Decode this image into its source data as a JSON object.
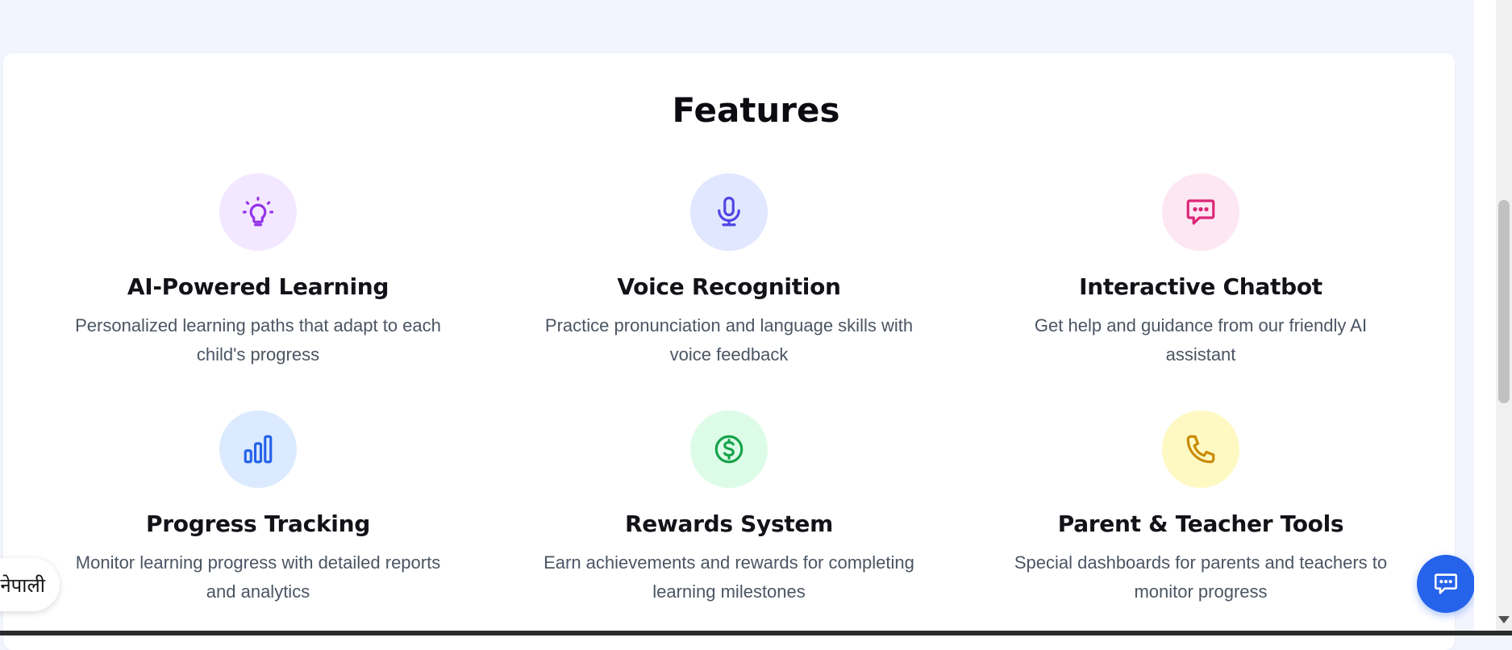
{
  "section": {
    "title": "Features"
  },
  "features": [
    {
      "title": "AI-Powered Learning",
      "desc_line1": "Personalized learning paths that adapt to each",
      "desc_line2": "child's progress",
      "icon": "lightbulb-icon",
      "bg": "#f3e8ff",
      "color": "#9333ea"
    },
    {
      "title": "Voice Recognition",
      "desc_line1": "Practice pronunciation and language skills with",
      "desc_line2": "voice feedback",
      "icon": "microphone-icon",
      "bg": "#e0e7ff",
      "color": "#4f46e5"
    },
    {
      "title": "Interactive Chatbot",
      "desc_line1": "Get help and guidance from our friendly AI",
      "desc_line2": "assistant",
      "icon": "chat-bubble-icon",
      "bg": "#fce7f3",
      "color": "#db2777"
    },
    {
      "title": "Progress Tracking",
      "desc_line1": "Monitor learning progress with detailed reports",
      "desc_line2": "and analytics",
      "icon": "bar-chart-icon",
      "bg": "#dbeafe",
      "color": "#2563eb"
    },
    {
      "title": "Rewards System",
      "desc_line1": "Earn achievements and rewards for completing",
      "desc_line2": "learning milestones",
      "icon": "dollar-coin-icon",
      "bg": "#dcfce7",
      "color": "#16a34a"
    },
    {
      "title": "Parent & Teacher Tools",
      "desc_line1": "Special dashboards for parents and teachers to",
      "desc_line2": "monitor progress",
      "icon": "phone-icon",
      "bg": "#fef9c3",
      "color": "#ca8a04"
    }
  ],
  "language_toggle": {
    "label": "नेपाली"
  },
  "chat_button": {
    "icon": "chat-icon",
    "color": "#2563eb"
  }
}
